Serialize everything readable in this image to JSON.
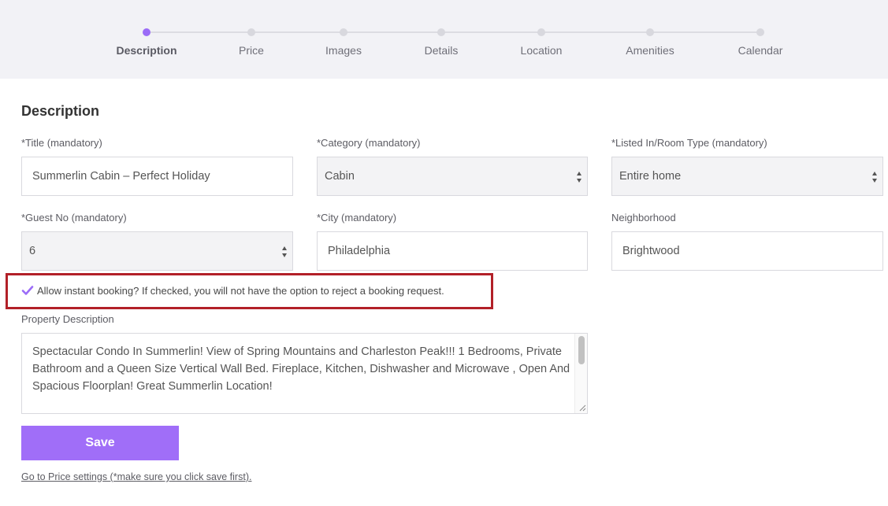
{
  "stepper": {
    "steps": [
      {
        "label": "Description",
        "active": true
      },
      {
        "label": "Price",
        "active": false
      },
      {
        "label": "Images",
        "active": false
      },
      {
        "label": "Details",
        "active": false
      },
      {
        "label": "Location",
        "active": false
      },
      {
        "label": "Amenities",
        "active": false
      },
      {
        "label": "Calendar",
        "active": false
      }
    ]
  },
  "form": {
    "section_title": "Description",
    "title": {
      "label": "*Title (mandatory)",
      "value": "Summerlin Cabin – Perfect Holiday"
    },
    "category": {
      "label": "*Category (mandatory)",
      "value": "Cabin"
    },
    "room_type": {
      "label": "*Listed In/Room Type (mandatory)",
      "value": "Entire home"
    },
    "guest_no": {
      "label": "*Guest No (mandatory)",
      "value": "6"
    },
    "city": {
      "label": "*City (mandatory)",
      "value": "Philadelphia"
    },
    "neighborhood": {
      "label": "Neighborhood",
      "value": "Brightwood"
    },
    "instant_booking": {
      "label": "Allow instant booking? If checked, you will not have the option to reject a booking request.",
      "checked": true
    },
    "property_description": {
      "label": "Property Description",
      "value": "Spectacular Condo In Summerlin! View of Spring Mountains and Charleston Peak!!! 1 Bedrooms, Private Bathroom and a Queen Size Vertical Wall Bed. Fireplace, Kitchen, Dishwasher and Microwave , Open And Spacious Floorplan! Great Summerlin Location!"
    },
    "save_label": "Save",
    "next_link": "Go to Price settings (*make sure you click save first)."
  },
  "colors": {
    "accent": "#a06ef8",
    "active_dot": "#9b6cf7",
    "highlight": "#b22028",
    "stepper_bg": "#f2f2f6"
  },
  "icons": {
    "checkbox": "check-icon",
    "select": "updown-arrows-icon",
    "textarea_resize": "resize-grip-icon"
  }
}
